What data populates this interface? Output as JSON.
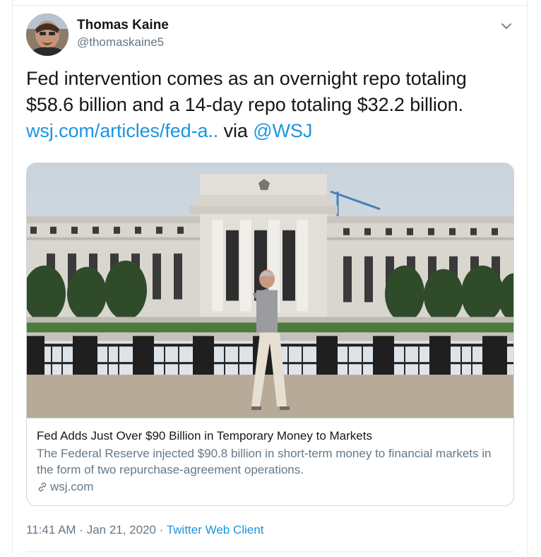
{
  "author": {
    "name": "Thomas Kaine",
    "handle": "@thomaskaine5",
    "avatar_icon": "user-avatar-photo"
  },
  "menu_icon": "chevron-down-icon",
  "tweet": {
    "text_line1": "Fed intervention comes as an overnight repo totaling",
    "text_line2": "$58.6 billion and a 14-day repo totaling $32.2 billion.",
    "link": "wsj.com/articles/fed-a..",
    "via": " via ",
    "mention": "@WSJ"
  },
  "card": {
    "image_icon": "federal-reserve-building-photo",
    "title": "Fed Adds Just Over $90 Billion in Temporary Money to Markets",
    "description": "The Federal Reserve injected $90.8 billion in short-term money to financial markets in the form of two repurchase-agreement operations.",
    "domain": "wsj.com",
    "domain_icon": "link-icon"
  },
  "meta": {
    "time": "11:41 AM",
    "separator1": " · ",
    "date": "Jan 21, 2020",
    "separator2": " · ",
    "client": "Twitter Web Client"
  },
  "colors": {
    "link": "#1b95e0",
    "secondary_text": "#657786",
    "border": "#ccd6dd"
  }
}
